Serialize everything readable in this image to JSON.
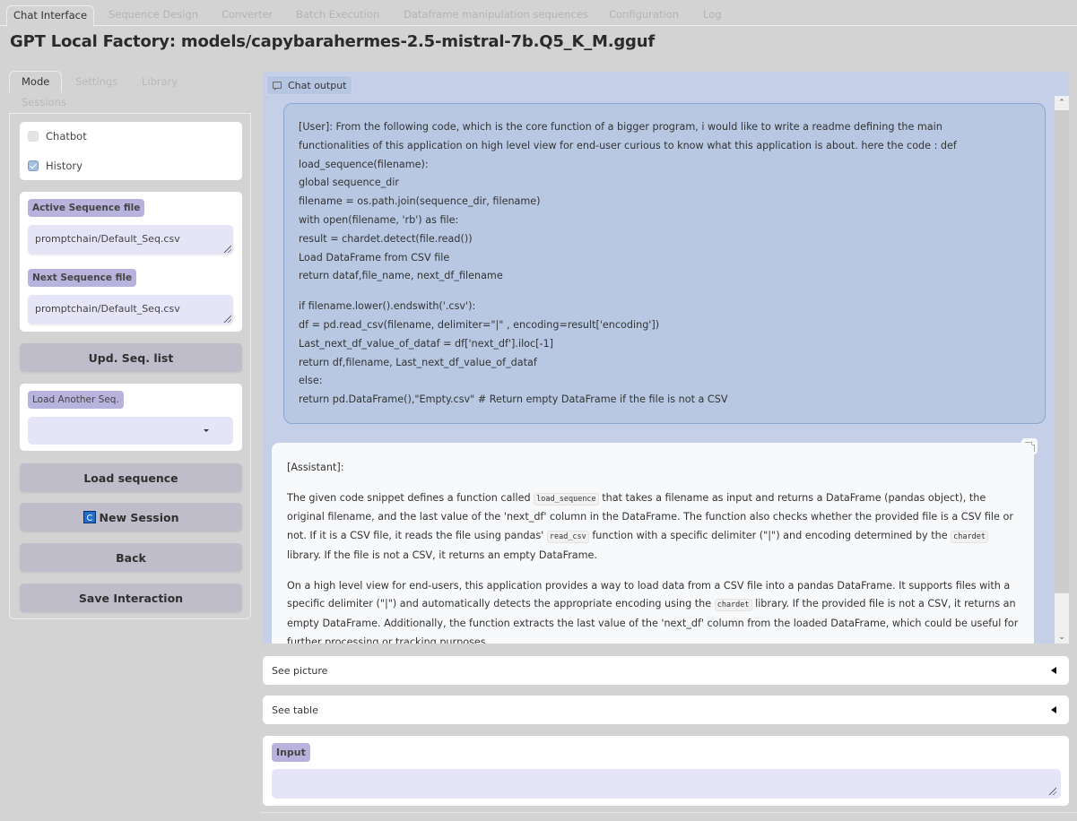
{
  "top_tabs": [
    {
      "label": "Chat Interface",
      "active": true
    },
    {
      "label": "Sequence Design",
      "active": false
    },
    {
      "label": "Converter",
      "active": false
    },
    {
      "label": "Batch Execution",
      "active": false
    },
    {
      "label": "Dataframe manipulation sequences",
      "active": false
    },
    {
      "label": "Configuration",
      "active": false
    },
    {
      "label": "Log",
      "active": false
    }
  ],
  "page_title": "GPT Local Factory: models/capybarahermes-2.5-mistral-7b.Q5_K_M.gguf",
  "left": {
    "tabs": [
      {
        "label": "Mode",
        "active": true
      },
      {
        "label": "Settings",
        "active": false
      },
      {
        "label": "Library",
        "active": false
      },
      {
        "label": "Sessions",
        "active": false
      }
    ],
    "checkboxes": [
      {
        "label": "Chatbot",
        "checked": false
      },
      {
        "label": "History",
        "checked": true
      }
    ],
    "active_seq_label": "Active Sequence file",
    "active_seq_value": "promptchain/Default_Seq.csv",
    "next_seq_label": "Next Sequence file",
    "next_seq_value": "promptchain/Default_Seq.csv",
    "upd_seq_button": "Upd. Seq. list",
    "load_another_label": "Load Another Seq.",
    "load_another_value": "",
    "load_sequence_button": "Load sequence",
    "new_session_button": "New Session",
    "new_session_icon": "refresh-icon",
    "back_button": "Back",
    "save_interaction_button": "Save Interaction"
  },
  "chat": {
    "label": "Chat output",
    "label_icon": "chat-bubble-icon",
    "user_message": {
      "lines_1": [
        "[User]: From the following code, which is the core function of a bigger program, i would like to write a readme defining the main",
        "functionalities of this application on high level view for end-user curious to know what this application is about. here the code : def",
        "load_sequence(filename):",
        "global sequence_dir",
        "filename = os.path.join(sequence_dir, filename)",
        "with open(filename, 'rb') as file:",
        "result = chardet.detect(file.read())",
        "Load DataFrame from CSV file",
        "return dataf,file_name, next_df_filename"
      ],
      "lines_2": [
        "if filename.lower().endswith('.csv'):",
        "df = pd.read_csv(filename, delimiter=\"|\" , encoding=result['encoding'])",
        "Last_next_df_value_of_dataf = df['next_df'].iloc[-1]",
        "return df,filename, Last_next_df_value_of_dataf",
        "else:",
        "return pd.DataFrame(),\"Empty.csv\" # Return empty DataFrame if the file is not a CSV"
      ]
    },
    "assistant_message": {
      "role": "[Assistant]:",
      "p1": [
        "The given code snippet defines a function called ",
        {
          "code": "load_sequence"
        },
        " that takes a filename as input and returns a DataFrame (pandas object), the original filename, and the last value of the 'next_df' column in the DataFrame. The function also checks whether the provided file is a CSV file or not. If it is a CSV file, it reads the file using pandas' ",
        {
          "code": "read_csv"
        },
        " function with a specific delimiter (\"|\") and encoding determined by the ",
        {
          "code": "chardet"
        },
        " library. If the file is not a CSV, it returns an empty DataFrame."
      ],
      "p2": [
        "On a high level view for end-users, this application provides a way to load data from a CSV file into a pandas DataFrame. It supports files with a specific delimiter (\"|\") and automatically detects the appropriate encoding using the ",
        {
          "code": "chardet"
        },
        " library. If the provided file is not a CSV, it returns an empty DataFrame. Additionally, the function extracts the last value of the 'next_df' column from the loaded DataFrame, which could be useful for further processing or tracking purposes."
      ]
    }
  },
  "accordions": [
    {
      "label": "See picture",
      "expanded": false
    },
    {
      "label": "See table",
      "expanded": false
    }
  ],
  "input": {
    "label": "Input",
    "value": ""
  }
}
